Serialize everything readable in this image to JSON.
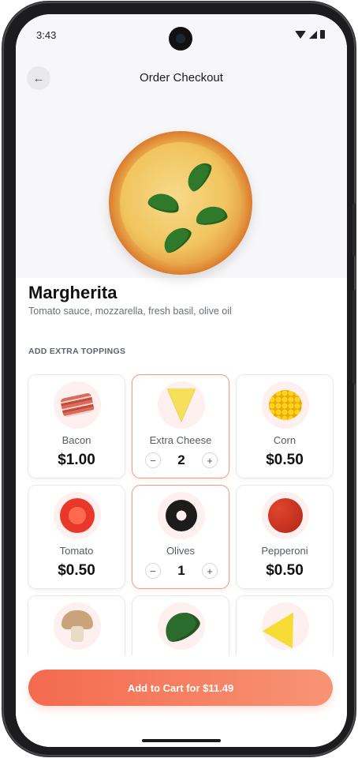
{
  "status_bar": {
    "time": "3:43",
    "icons": [
      "wifi-icon",
      "cellular-icon",
      "battery-icon"
    ]
  },
  "header": {
    "title": "Order Checkout",
    "back_icon": "←"
  },
  "product": {
    "name": "Margherita",
    "description": "Tomato sauce, mozzarella, fresh basil, olive oil"
  },
  "toppings_section": {
    "label": "ADD EXTRA TOPPINGS",
    "items": [
      {
        "name": "Bacon",
        "price": "$1.00",
        "selected": false,
        "icon": "bacon-icon"
      },
      {
        "name": "Extra Cheese",
        "selected": true,
        "quantity": "2",
        "icon": "cheese-icon"
      },
      {
        "name": "Corn",
        "price": "$0.50",
        "selected": false,
        "icon": "corn-icon"
      },
      {
        "name": "Tomato",
        "price": "$0.50",
        "selected": false,
        "icon": "tomato-icon"
      },
      {
        "name": "Olives",
        "selected": true,
        "quantity": "1",
        "icon": "olive-icon"
      },
      {
        "name": "Pepperoni",
        "price": "$0.50",
        "selected": false,
        "icon": "pepperoni-icon"
      },
      {
        "name": "",
        "selected": false,
        "icon": "mushroom-icon"
      },
      {
        "name": "",
        "selected": false,
        "icon": "spinach-icon"
      },
      {
        "name": "",
        "selected": false,
        "icon": "pineapple-icon"
      }
    ],
    "stepper": {
      "minus": "−",
      "plus": "+"
    }
  },
  "cart_button": {
    "label": "Add to Cart for $11.49"
  },
  "colors": {
    "accent": "#f46a4f",
    "selected_border": "#f29a84",
    "icon_bg": "#fdf0ee"
  }
}
